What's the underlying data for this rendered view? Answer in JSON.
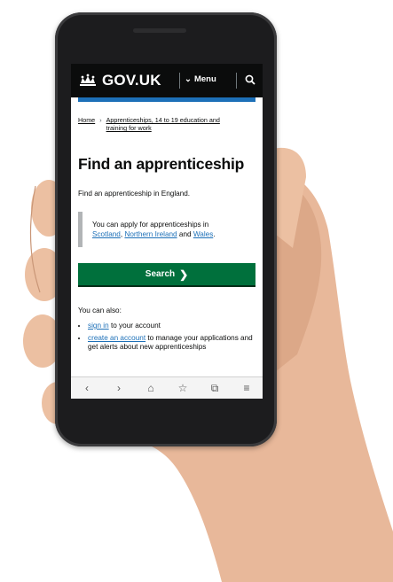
{
  "header": {
    "logo_text": "GOV.UK",
    "menu_label": "Menu",
    "menu_icon": "chevron-down-icon",
    "search_icon": "search-icon",
    "bg_color": "#0b0c0c",
    "accent_color": "#1d70b8"
  },
  "breadcrumb": {
    "home": "Home",
    "current_line1": "Apprenticeships, 14 to 19 education and",
    "current_line2": "training for work"
  },
  "page": {
    "title": "Find an apprenticeship",
    "lede": "Find an apprenticeship in England.",
    "inset_prefix": "You can apply for apprenticeships in",
    "inset_link_scotland": "Scotland",
    "inset_link_ni": "Northern Ireland",
    "inset_and": "and",
    "inset_link_wales": "Wales",
    "search_button": "Search",
    "search_button_color": "#00703c",
    "also_label": "You can also:",
    "options": [
      {
        "link": "sign in",
        "rest": "to your account"
      },
      {
        "link": "create an account",
        "rest": "to manage your applications and get alerts about new apprenticeships"
      }
    ]
  },
  "browser_bar": {
    "icons": [
      "back-icon",
      "forward-icon",
      "home-icon",
      "bookmark-icon",
      "tabs-icon",
      "menu-icon"
    ],
    "glyphs": [
      "‹",
      "›",
      "⌂",
      "☆",
      "⧉",
      "≡"
    ]
  }
}
